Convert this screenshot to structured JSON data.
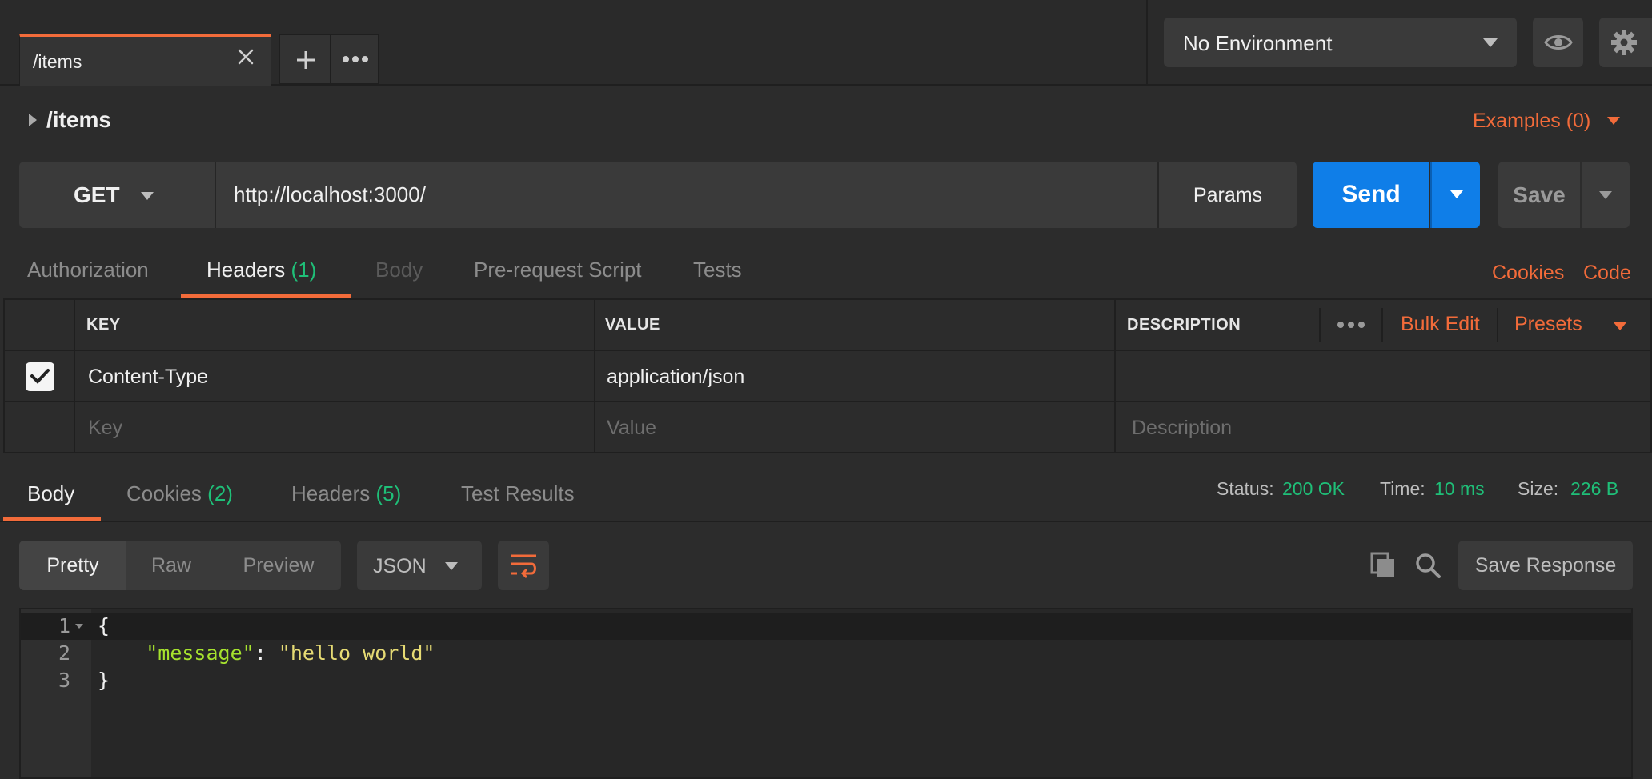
{
  "tabs": [
    {
      "title": "/items"
    }
  ],
  "environment": {
    "selected": "No Environment"
  },
  "request": {
    "title": "/items",
    "examples_label": "Examples (0)",
    "method": "GET",
    "url": "http://localhost:3000/",
    "params_label": "Params",
    "send_label": "Send",
    "save_label": "Save"
  },
  "request_tabs": {
    "authorization": "Authorization",
    "headers": "Headers",
    "headers_count": "(1)",
    "body": "Body",
    "prerequest": "Pre-request Script",
    "tests": "Tests",
    "cookies_link": "Cookies",
    "code_link": "Code"
  },
  "headers_table": {
    "columns": {
      "key": "KEY",
      "value": "VALUE",
      "description": "DESCRIPTION"
    },
    "bulk_edit": "Bulk Edit",
    "presets": "Presets",
    "rows": [
      {
        "checked": true,
        "key": "Content-Type",
        "value": "application/json",
        "description": ""
      }
    ],
    "placeholders": {
      "key": "Key",
      "value": "Value",
      "description": "Description"
    }
  },
  "response_tabs": {
    "body": "Body",
    "cookies": "Cookies",
    "cookies_count": "(2)",
    "headers": "Headers",
    "headers_count": "(5)",
    "test_results": "Test Results"
  },
  "response_stats": {
    "status_label": "Status:",
    "status_value": "200 OK",
    "time_label": "Time:",
    "time_value": "10 ms",
    "size_label": "Size:",
    "size_value": "226 B"
  },
  "response_toolbar": {
    "pretty": "Pretty",
    "raw": "Raw",
    "preview": "Preview",
    "format": "JSON",
    "save_response": "Save Response"
  },
  "response_body": {
    "line_numbers": [
      "1",
      "2",
      "3"
    ],
    "open_brace": "{",
    "key": "\"message\"",
    "sep": ": ",
    "value": "\"hello world\"",
    "close_brace": "}"
  },
  "colors": {
    "accent": "#f26b3a",
    "send": "#0f7ee8",
    "success": "#1fbf78"
  }
}
